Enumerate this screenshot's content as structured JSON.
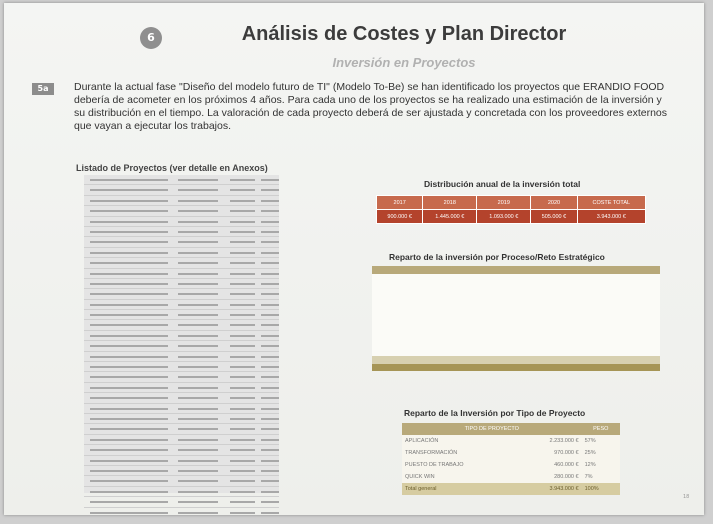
{
  "badge": "6",
  "title": "Análisis de Costes y Plan Director",
  "subtitle": "Inversión en Proyectos",
  "bullet_icon": "5a",
  "intro": "Durante la actual fase \"Diseño del modelo futuro de TI\" (Modelo To-Be) se han identificado los proyectos que ERANDIO FOOD debería de acometer en los próximos 4 años. Para cada uno de los proyectos se ha realizado una estimación de la inversión y su distribución en el tiempo. La valoración de cada proyecto deberá de ser ajustada y concretada con los proveedores externos que vayan a ejecutar los trabajos.",
  "list_title": "Listado de Proyectos (ver detalle en Anexos)",
  "annual": {
    "title": "Distribución anual de la inversión total",
    "headers": [
      "2017",
      "2018",
      "2019",
      "2020",
      "COSTE TOTAL"
    ],
    "values": [
      "900.000 €",
      "1.445.000 €",
      "1.093.000 €",
      "505.000 €",
      "3.943.000 €"
    ]
  },
  "process": {
    "title": "Reparto de la inversión por Proceso/Reto Estratégico"
  },
  "type_table": {
    "title": "Reparto de la Inversión por Tipo de Proyecto",
    "headers": [
      "TIPO DE PROYECTO",
      "",
      "PESO"
    ],
    "rows": [
      {
        "tipo": "APLICACIÓN",
        "valor": "2.233.000 €",
        "peso": "57%"
      },
      {
        "tipo": "TRANSFORMACIÓN",
        "valor": "970.000 €",
        "peso": "25%"
      },
      {
        "tipo": "PUESTO DE TRABAJO",
        "valor": "460.000 €",
        "peso": "12%"
      },
      {
        "tipo": "QUICK WIN",
        "valor": "280.000 €",
        "peso": "7%"
      }
    ],
    "total": {
      "tipo": "Total general",
      "valor": "3.943.000 €",
      "peso": "100%"
    }
  },
  "page_number": "18"
}
